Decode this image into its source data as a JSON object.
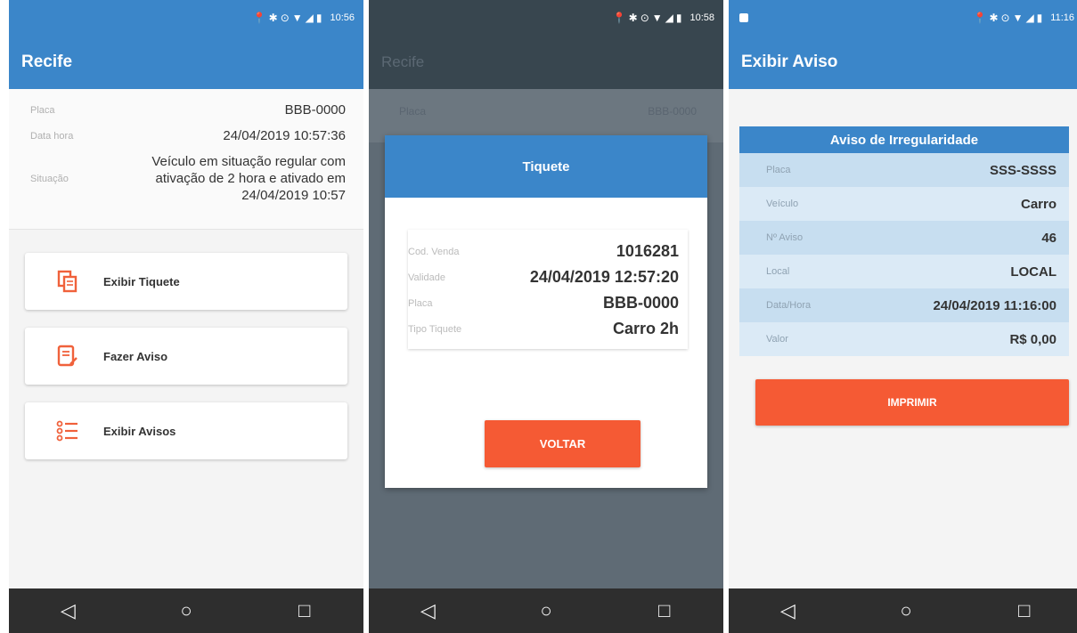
{
  "screen1": {
    "status_time": "10:56",
    "title": "Recife",
    "info": [
      {
        "label": "Placa",
        "value": "BBB-0000"
      },
      {
        "label": "Data hora",
        "value": "24/04/2019 10:57:36"
      },
      {
        "label": "Situação",
        "value": "Veículo em situação regular com ativação de 2 hora e ativado em 24/04/2019 10:57"
      }
    ],
    "menu": [
      {
        "label": "Exibir Tiquete",
        "icon": "copy-icon"
      },
      {
        "label": "Fazer Aviso",
        "icon": "document-edit-icon"
      },
      {
        "label": "Exibir Avisos",
        "icon": "list-icon"
      }
    ]
  },
  "screen2": {
    "status_time": "10:58",
    "title": "Recife",
    "behind": {
      "label": "Placa",
      "value": "BBB-0000"
    },
    "dialog": {
      "title": "Tiquete",
      "rows": [
        {
          "label": "Cod. Venda",
          "value": "1016281"
        },
        {
          "label": "Validade",
          "value": "24/04/2019 12:57:20"
        },
        {
          "label": "Placa",
          "value": "BBB-0000"
        },
        {
          "label": "Tipo Tiquete",
          "value": "Carro 2h"
        }
      ],
      "button": "VOLTAR"
    }
  },
  "screen3": {
    "status_time": "11:16",
    "title": "Exibir Aviso",
    "card_title": "Aviso de Irregularidade",
    "rows": [
      {
        "label": "Placa",
        "value": "SSS-SSSS"
      },
      {
        "label": "Veículo",
        "value": "Carro"
      },
      {
        "label": "Nº Aviso",
        "value": "46"
      },
      {
        "label": "Local",
        "value": "LOCAL"
      },
      {
        "label": "Data/Hora",
        "value": "24/04/2019 11:16:00"
      },
      {
        "label": "Valor",
        "value": "R$ 0,00"
      }
    ],
    "button": "IMPRIMIR"
  },
  "navbar": {
    "back": "◁",
    "home": "○",
    "recents": "□"
  },
  "colors": {
    "primary": "#3b86c9",
    "accent": "#f55a34",
    "navbar": "#2e2e2e"
  }
}
